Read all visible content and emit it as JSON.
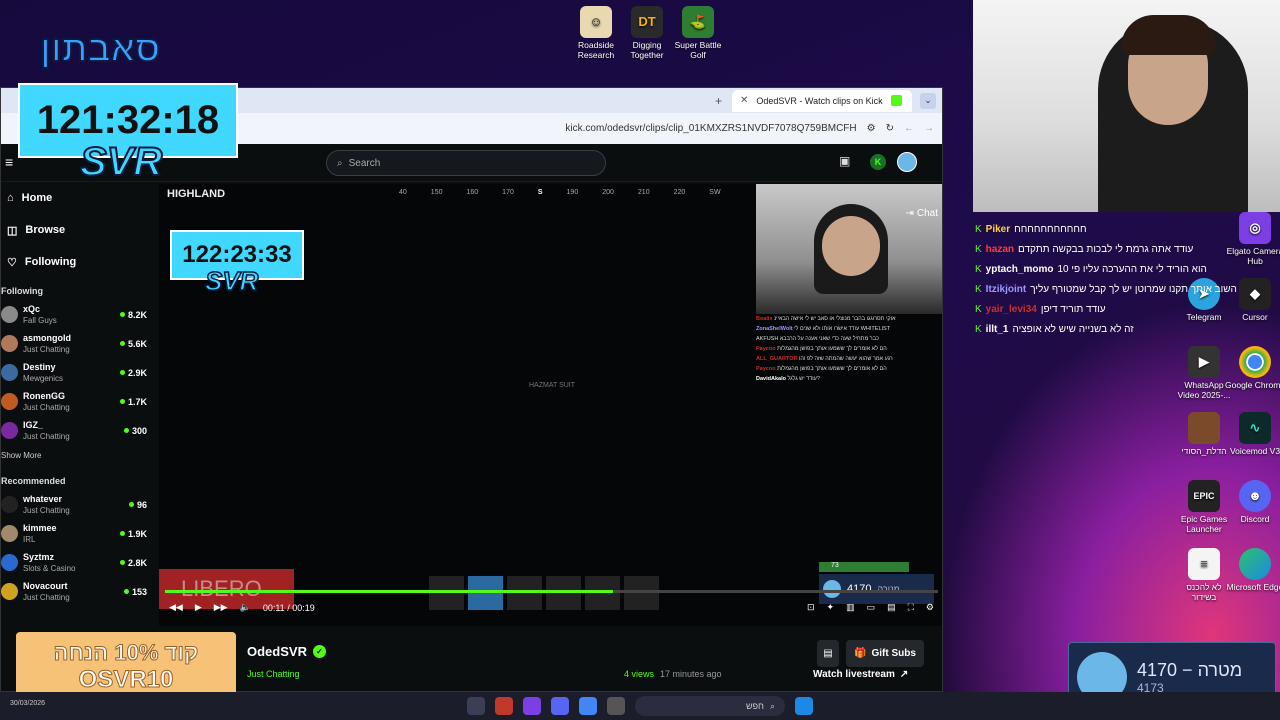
{
  "desktop_icons": [
    {
      "label": "Roadside Research",
      "icon": "roadside-icon",
      "color": "#e8d9b0"
    },
    {
      "label": "Digging Together",
      "icon": "dt-icon",
      "color": "#2a2a2a",
      "glyph": "DT"
    },
    {
      "label": "Super Battle Golf",
      "icon": "golf-icon",
      "color": "#2e7d32"
    },
    {
      "label": "Elgato Camera Hub",
      "icon": "camera-hub-icon",
      "color": "#7b3fe4"
    },
    {
      "label": "Telegram",
      "icon": "telegram-icon",
      "color": "#2aa3df"
    },
    {
      "label": "Cursor",
      "icon": "cursor-icon",
      "color": "#222"
    },
    {
      "label": "WhatsApp Video 2025-...",
      "icon": "video-file-icon",
      "color": "#333"
    },
    {
      "label": "Google Chrome",
      "icon": "chrome-icon",
      "color": "#e8453c"
    },
    {
      "label": "הדלת_הסודי",
      "icon": "folder-image-icon",
      "color": "#7a4a2a"
    },
    {
      "label": "Voicemod V3",
      "icon": "voicemod-icon",
      "color": "#0c2a2a"
    },
    {
      "label": "Epic Games Launcher",
      "icon": "epic-icon",
      "color": "#222",
      "glyph": "EPIC"
    },
    {
      "label": "Discord",
      "icon": "discord-icon",
      "color": "#5865f2"
    },
    {
      "label": "לא להכנס בשידור",
      "icon": "text-file-icon",
      "color": "#f4f4f4"
    },
    {
      "label": "Microsoft Edge",
      "icon": "edge-icon",
      "color": "#1e88e5"
    }
  ],
  "browser": {
    "tab_title": "OdedSVR - Watch clips on Kick",
    "url": "kick.com/odedsvr/clips/clip_01KMXZRS1NVDF7078Q759BMCFH",
    "search_placeholder": "Search",
    "nav": {
      "home": "Home",
      "browse": "Browse",
      "following": "Following"
    },
    "following_title": "Following",
    "following": [
      {
        "name": "xQc",
        "category": "Fall Guys",
        "viewers": "8.2K"
      },
      {
        "name": "asmongold",
        "category": "Just Chatting",
        "viewers": "5.6K"
      },
      {
        "name": "Destiny",
        "category": "Mewgenics",
        "viewers": "2.9K"
      },
      {
        "name": "RonenGG",
        "category": "Just Chatting",
        "viewers": "1.7K"
      },
      {
        "name": "IGZ_",
        "category": "Just Chatting",
        "viewers": "300"
      }
    ],
    "show_more": "Show More",
    "recommended_title": "Recommended",
    "recommended": [
      {
        "name": "whatever",
        "category": "Just Chatting",
        "viewers": "96"
      },
      {
        "name": "kimmee",
        "category": "IRL",
        "viewers": "1.9K"
      },
      {
        "name": "Syztmz",
        "category": "Slots & Casino",
        "viewers": "2.8K"
      },
      {
        "name": "Novacourt",
        "category": "Just Chatting",
        "viewers": "153"
      }
    ],
    "player": {
      "compass": [
        "40",
        "150",
        "160",
        "170",
        "S",
        "190",
        "200",
        "210",
        "220",
        "SW"
      ],
      "hazmat": "HAZMAT SUIT",
      "chat_toggle": "Chat",
      "chat_lines": [
        {
          "user": "Boalix",
          "text": "אוקי תסרוגגו בהבר מנוצלי או סאב יש לי אישה הבאיינ"
        },
        {
          "user": "ZonaShelWolt",
          "text": "עודד אישרו אותו ולא שנים לי WHITELIST"
        },
        {
          "user": "",
          "text": "AKFUSH כבר מתחיל שעה כדי שאני אענה על הרבבא"
        },
        {
          "user": "Paycoo",
          "text": "הם לא אומרים לך ששמעו אותך בפושן מהגמלות"
        },
        {
          "user": "ALL_GUARTOR",
          "text": "רגע אמר שהוא יעשה שהמתה שזה לפ והו"
        },
        {
          "user": "Paycoo",
          "text": "הם לא אומרים לך ששמעו אותך בפושן מהגמלות"
        },
        {
          "user": "DavidAkalo",
          "text": "עודד יש גלגל?"
        }
      ],
      "time_current": "00:11",
      "time_total": "00:19",
      "progress": 0.58,
      "hud_value": "4170",
      "hud_label": "מטרה",
      "hud_health": "73"
    },
    "below": {
      "channel_name": "OdedSVR",
      "category": "Just Chatting",
      "views": "4 views",
      "ago": "17 minutes ago",
      "gift_subs": "Gift Subs",
      "watch_livestream": "Watch livestream"
    }
  },
  "overlays": {
    "title_text": "סאבתון",
    "timer_big": "121:32:18",
    "svr_big": "SVR",
    "highlight": "HIGHLAND",
    "timer_small": "122:23:33",
    "svr_small": "SVR",
    "promo_line1": "קוד 10% הנחה",
    "promo_line2": "OSVR10",
    "libero": "LIBERO"
  },
  "stream_chat": [
    {
      "user": "Piker",
      "text": "חחחחחחחחחחח",
      "color": "#ffd23a"
    },
    {
      "user": "hazan",
      "text": "עודד אתה גרמת לי לבכות בבקשה תתקדם",
      "color": "#ff3a3a"
    },
    {
      "user": "yptach_momo",
      "text": "הוא הוריד לי את ההערכה עליו פי 10",
      "color": "#ffffff"
    },
    {
      "user": "Itzikjoint",
      "text": "השוב אותך תקנו שמרוטן יש לך קבל שמטורף עליך",
      "color": "#9a9aff"
    },
    {
      "user": "yair_levi34",
      "text": "עודד תוריד דיפן",
      "color": "#c9302c"
    },
    {
      "user": "illt_1",
      "text": "זה לא בשנייה שיש לא אופציה",
      "color": "#ffffff"
    }
  ],
  "goal": {
    "label": "מטרה",
    "value": "4170",
    "current": "4173"
  },
  "taskbar": {
    "date": "30/03/2026",
    "search": "חפש"
  }
}
